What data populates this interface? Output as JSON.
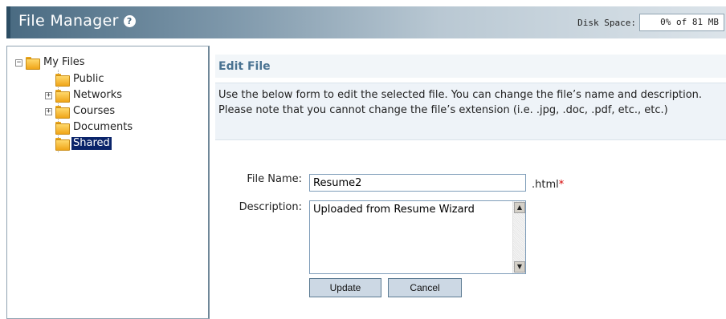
{
  "header": {
    "title": "File Manager",
    "help_icon": "?",
    "disk_label": "Disk Space:",
    "disk_value": "0% of 81 MB"
  },
  "tree": {
    "root": "My Files",
    "items": [
      {
        "label": "Public",
        "expander": ""
      },
      {
        "label": "Networks",
        "expander": "+"
      },
      {
        "label": "Courses",
        "expander": "+"
      },
      {
        "label": "Documents",
        "expander": ""
      },
      {
        "label": "Shared",
        "expander": "",
        "selected": true
      }
    ]
  },
  "main": {
    "title": "Edit File",
    "instructions": "Use the below form to edit the selected file. You can change the file’s name and description. Please note that you cannot change the file’s extension (i.e. .jpg, .doc, .pdf, etc., etc.)",
    "file_name_label": "File Name:",
    "file_name_value": "Resume2",
    "extension": ".html",
    "required_mark": "*",
    "description_label": "Description:",
    "description_value": "Uploaded from Resume Wizard",
    "update_label": "Update",
    "cancel_label": "Cancel"
  },
  "colors": {
    "header_dark": "#2c4d63",
    "accent_title": "#4a7392",
    "selection": "#0a246a",
    "required": "#d40000"
  }
}
